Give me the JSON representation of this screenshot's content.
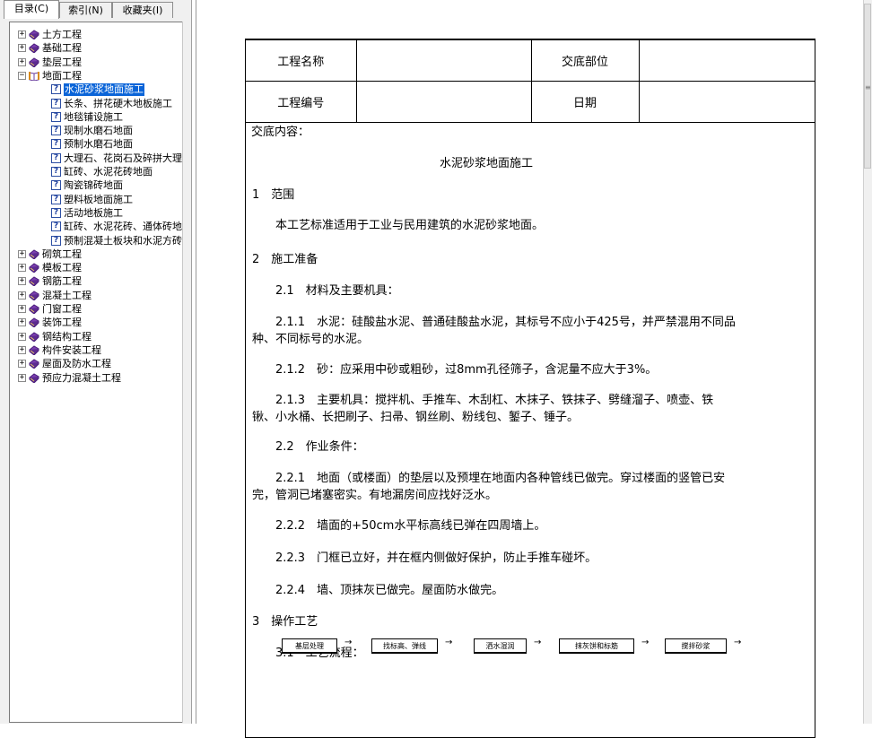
{
  "sidebar": {
    "tabs": [
      {
        "label": "目录(C)"
      },
      {
        "label": "索引(N)"
      },
      {
        "label": "收藏夹(I)"
      }
    ],
    "tree": [
      {
        "label": "土方工程",
        "kind": "book",
        "expander": "+"
      },
      {
        "label": "基础工程",
        "kind": "book",
        "expander": "+"
      },
      {
        "label": "垫层工程",
        "kind": "book",
        "expander": "+"
      },
      {
        "label": "地面工程",
        "kind": "open-book",
        "expander": "−"
      },
      {
        "label": "水泥砂浆地面施工",
        "kind": "topic",
        "selected": true
      },
      {
        "label": "长条、拼花硬木地板施工",
        "kind": "topic"
      },
      {
        "label": "地毯铺设施工",
        "kind": "topic"
      },
      {
        "label": "现制水磨石地面",
        "kind": "topic"
      },
      {
        "label": "预制水磨石地面",
        "kind": "topic"
      },
      {
        "label": "大理石、花岗石及碎拼大理",
        "kind": "topic"
      },
      {
        "label": "缸砖、水泥花砖地面",
        "kind": "topic"
      },
      {
        "label": "陶瓷锦砖地面",
        "kind": "topic"
      },
      {
        "label": "塑料板地面施工",
        "kind": "topic"
      },
      {
        "label": "活动地板施工",
        "kind": "topic"
      },
      {
        "label": "缸砖、水泥花砖、通体砖地",
        "kind": "topic"
      },
      {
        "label": "预制混凝土板块和水泥方砖",
        "kind": "topic"
      },
      {
        "label": "砌筑工程",
        "kind": "book",
        "expander": "+"
      },
      {
        "label": "模板工程",
        "kind": "book",
        "expander": "+"
      },
      {
        "label": "钢筋工程",
        "kind": "book",
        "expander": "+"
      },
      {
        "label": "混凝土工程",
        "kind": "book",
        "expander": "+"
      },
      {
        "label": "门窗工程",
        "kind": "book",
        "expander": "+"
      },
      {
        "label": "装饰工程",
        "kind": "book",
        "expander": "+"
      },
      {
        "label": "钢结构工程",
        "kind": "book",
        "expander": "+"
      },
      {
        "label": "构件安装工程",
        "kind": "book",
        "expander": "+"
      },
      {
        "label": "屋面及防水工程",
        "kind": "book",
        "expander": "+"
      },
      {
        "label": "预应力混凝土工程",
        "kind": "book",
        "expander": "+"
      }
    ]
  },
  "document": {
    "header": {
      "project_name_label": "工程名称",
      "project_name_value": "",
      "location_label": "交底部位",
      "location_value": "",
      "project_no_label": "工程编号",
      "project_no_value": "",
      "date_label": "日期",
      "date_value": ""
    },
    "content_label": "交底内容：",
    "title": "水泥砂浆地面施工",
    "paragraphs": [
      "1　范围",
      "　　本工艺标准适用于工业与民用建筑的水泥砂浆地面。",
      "2　施工准备",
      "　　2.1　材料及主要机具：",
      "　　2.1.1　水泥：硅酸盐水泥、普通硅酸盐水泥，其标号不应小于425号，并严禁混用不同品种、不同标号的水泥。",
      "　　2.1.2　砂：应采用中砂或粗砂，过8mm孔径筛子，含泥量不应大于3%。",
      "　　2.1.3　主要机具：搅拌机、手推车、木刮杠、木抹子、铁抹子、劈缝溜子、喷壶、铁锹、小水桶、长把刷子、扫帚、钢丝刷、粉线包、錾子、锤子。",
      "　　2.2　作业条件：",
      "　　2.2.1　地面（或楼面）的垫层以及预埋在地面内各种管线已做完。穿过楼面的竖管已安完，管洞已堵塞密实。有地漏房间应找好泛水。",
      "　　2.2.2　墙面的+50cm水平标高线已弹在四周墙上。",
      "　　2.2.3　门框已立好，并在框内侧做好保护，防止手推车碰坏。",
      "　　2.2.4　墙、顶抹灰已做完。屋面防水做完。",
      "3　操作工艺",
      "　　3.1　工艺流程："
    ],
    "flow_steps": [
      "基层处理",
      "找标高、弹线",
      "洒水湿润",
      "抹灰饼和标筋",
      "搅拌砂浆"
    ],
    "flow_arrow": "→"
  }
}
